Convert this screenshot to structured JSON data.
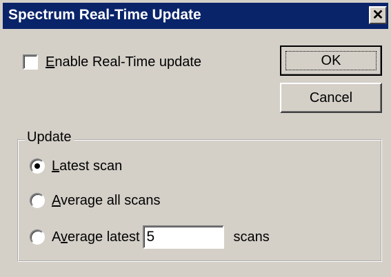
{
  "window": {
    "title": "Spectrum Real-Time Update",
    "close_glyph": "✕"
  },
  "enable_checkbox": {
    "label_key": "E",
    "label_rest": "nable Real-Time update",
    "checked": false
  },
  "buttons": {
    "ok_label": "OK",
    "cancel_label": "Cancel"
  },
  "update_group": {
    "legend": "Update",
    "options": [
      {
        "key": "L",
        "rest": "atest scan",
        "selected": true
      },
      {
        "key": "A",
        "rest": "verage all scans",
        "selected": false
      },
      {
        "prefix": "A",
        "key": "v",
        "rest": "erage latest",
        "selected": false
      }
    ],
    "latest_count_value": "5",
    "scans_suffix": "scans"
  },
  "colors": {
    "titlebar": "#0a246a",
    "face": "#d4d0c8"
  }
}
